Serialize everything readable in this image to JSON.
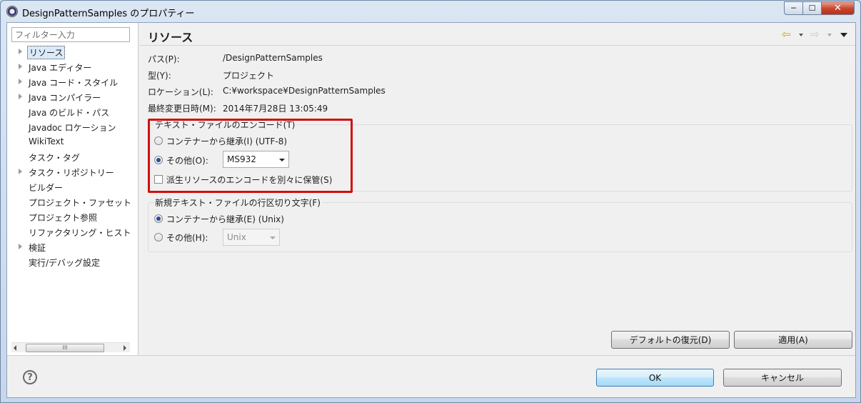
{
  "window": {
    "title": "DesignPatternSamples のプロパティー",
    "minimize_glyph": "─",
    "maximize_glyph": "☐",
    "close_glyph": "✕"
  },
  "sidebar": {
    "filter_placeholder": "フィルター入力",
    "items": [
      {
        "label": "リソース",
        "expandable": true,
        "selected": true
      },
      {
        "label": "Java エディター",
        "expandable": true
      },
      {
        "label": "Java コード・スタイル",
        "expandable": true
      },
      {
        "label": "Java コンパイラー",
        "expandable": true
      },
      {
        "label": "Java のビルド・パス",
        "expandable": false
      },
      {
        "label": "Javadoc ロケーション",
        "expandable": false
      },
      {
        "label": "WikiText",
        "expandable": false
      },
      {
        "label": "タスク・タグ",
        "expandable": false
      },
      {
        "label": "タスク・リポジトリー",
        "expandable": true
      },
      {
        "label": "ビルダー",
        "expandable": false
      },
      {
        "label": "プロジェクト・ファセット",
        "expandable": false
      },
      {
        "label": "プロジェクト参照",
        "expandable": false
      },
      {
        "label": "リファクタリング・ヒスト",
        "expandable": false
      },
      {
        "label": "検証",
        "expandable": true
      },
      {
        "label": "実行/デバッグ設定",
        "expandable": false
      }
    ],
    "scroll_thumb_glyph": "III"
  },
  "page": {
    "title": "リソース",
    "nav": {
      "back_glyph": "⇦",
      "forward_glyph": "⇨"
    },
    "info": [
      {
        "label": "パス(P):",
        "value": "/DesignPatternSamples"
      },
      {
        "label": "型(Y):",
        "value": "プロジェクト"
      },
      {
        "label": "ロケーション(L):",
        "value": "C:¥workspace¥DesignPatternSamples"
      },
      {
        "label": "最終変更日時(M):",
        "value": "2014年7月28日 13:05:49"
      }
    ],
    "encoding_group": {
      "title": "テキスト・ファイルのエンコード(T)",
      "inherit_label": "コンテナーから継承(I) (UTF-8)",
      "other_label": "その他(O):",
      "other_value": "MS932",
      "store_label": "派生リソースのエンコードを別々に保管(S)",
      "selected": "other"
    },
    "delimiter_group": {
      "title": "新規テキスト・ファイルの行区切り文字(F)",
      "inherit_label": "コンテナーから継承(E) (Unix)",
      "other_label": "その他(H):",
      "other_value": "Unix",
      "selected": "inherit"
    },
    "restore_defaults_label": "デフォルトの復元(D)",
    "apply_label": "適用(A)"
  },
  "footer": {
    "help_glyph": "?",
    "ok_label": "OK",
    "cancel_label": "キャンセル"
  }
}
